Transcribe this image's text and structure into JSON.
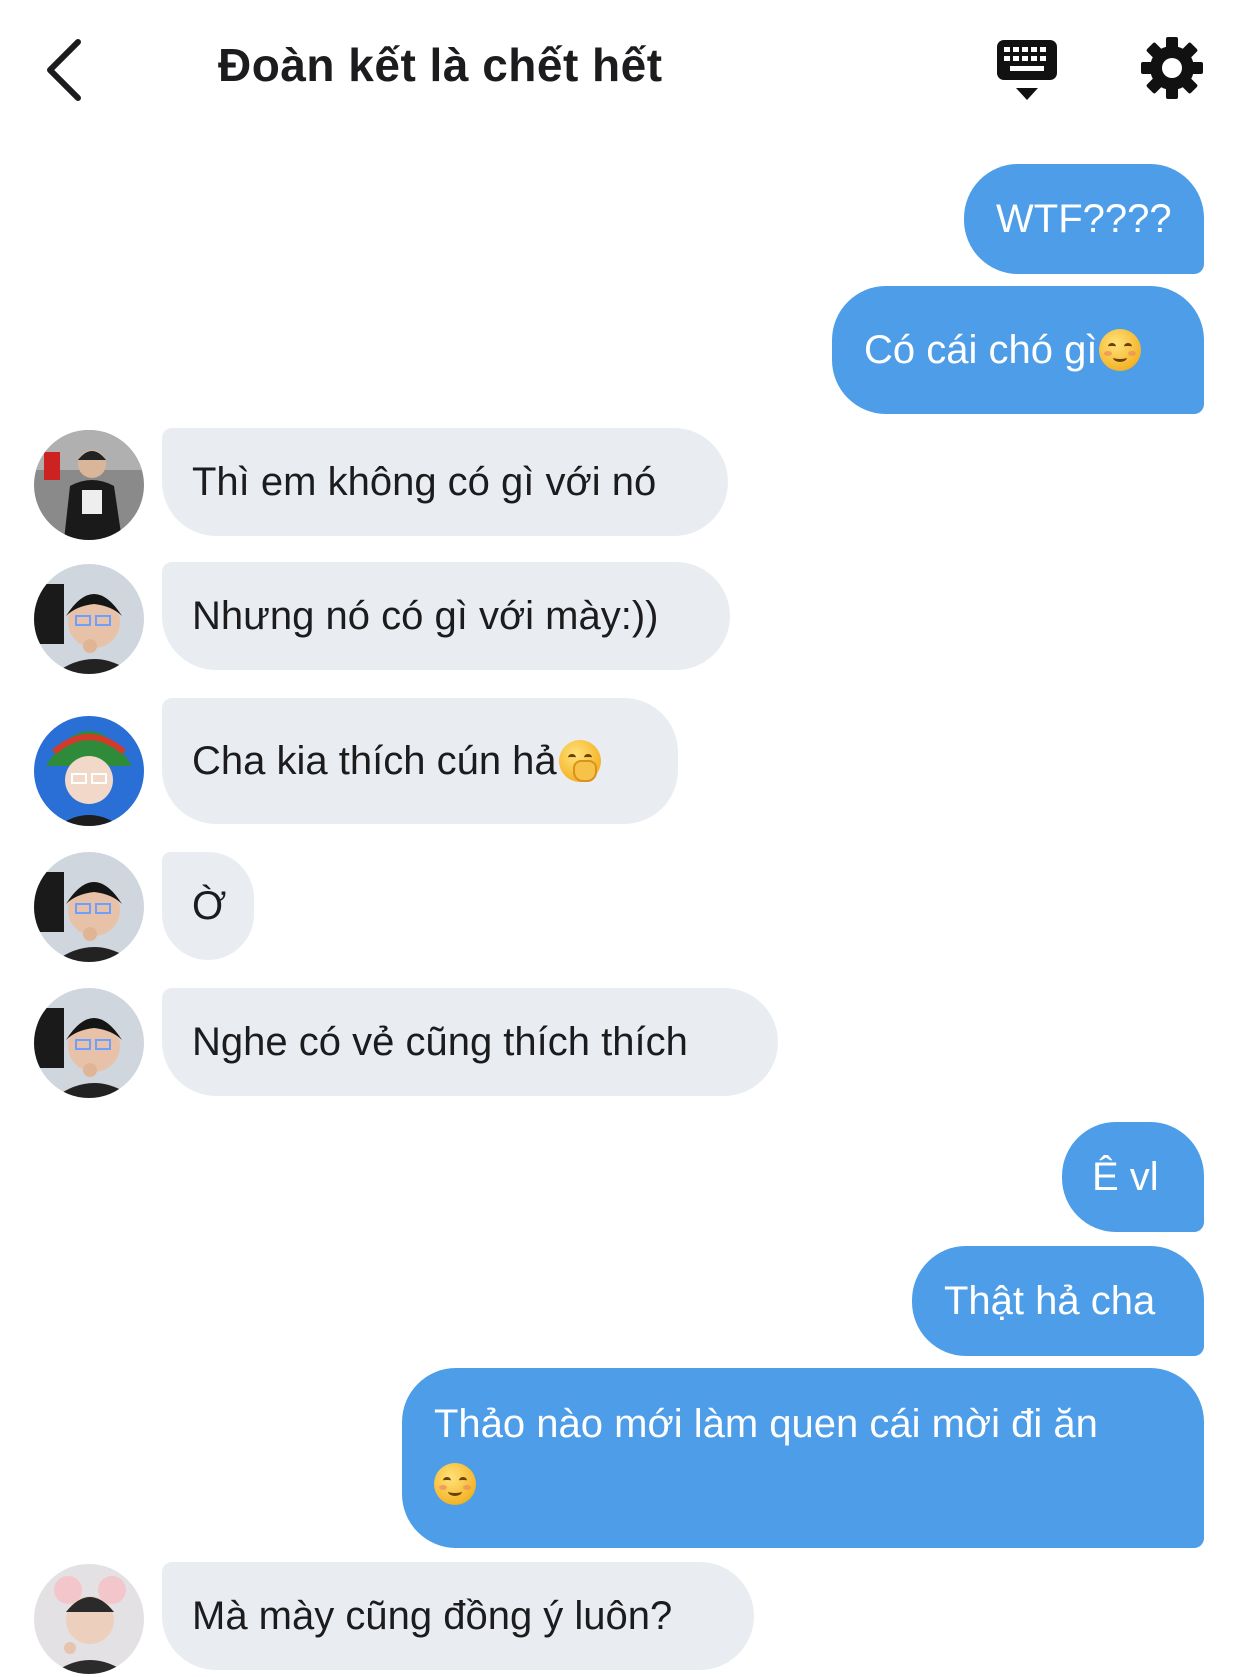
{
  "header": {
    "title": "Đoàn kết là chết hết",
    "back_icon": "chevron-left-icon",
    "keyboard_icon": "keyboard-icon",
    "settings_icon": "gear-icon"
  },
  "colors": {
    "outgoing_bubble": "#4d9de8",
    "incoming_bubble": "#e9edf1",
    "text_dark": "#1c1c1e",
    "text_light": "#ffffff"
  },
  "messages": [
    {
      "direction": "out",
      "text": "WTF????"
    },
    {
      "direction": "out",
      "text": "Có cái chó gì",
      "emoji": "smiling-face-icon"
    },
    {
      "direction": "in",
      "text": "Thì em không có gì với nó"
    },
    {
      "direction": "in",
      "text": "Nhưng nó có gì với mày:))"
    },
    {
      "direction": "in",
      "text": "Cha kia thích cún hả",
      "emoji": "face-with-hand-over-mouth-icon"
    },
    {
      "direction": "in",
      "text": "Ờ"
    },
    {
      "direction": "in",
      "text": "Nghe có vẻ cũng thích thích"
    },
    {
      "direction": "out",
      "text": "Ê vl"
    },
    {
      "direction": "out",
      "text": "Thật hả cha"
    },
    {
      "direction": "out",
      "text": "Thảo nào mới làm quen cái mời đi ăn",
      "emoji": "smiling-face-icon"
    },
    {
      "direction": "in",
      "text": "Mà mày cũng đồng ý luôn?"
    }
  ]
}
